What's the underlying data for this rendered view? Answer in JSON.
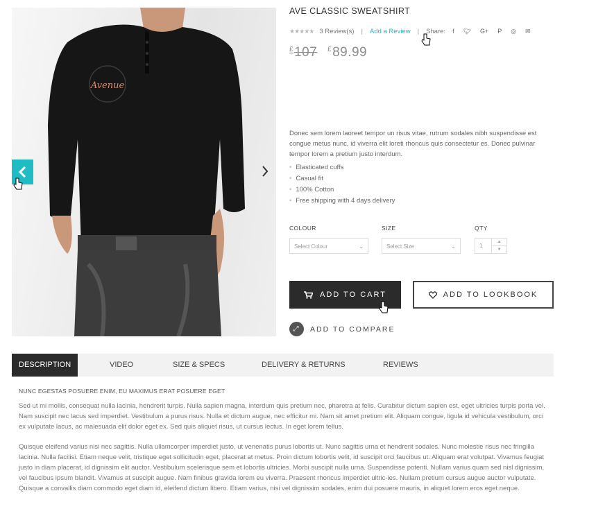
{
  "product": {
    "title": "AVE CLASSIC SWEATSHIRT",
    "logo_text": "Avenue",
    "rating_stars": 4.5,
    "reviews_label": "3 Review(s)",
    "add_review_label": "Add a Review",
    "share_label": "Share:",
    "share_icons": [
      "facebook-icon",
      "twitter-icon",
      "google-plus-icon",
      "pinterest-icon",
      "instagram-icon",
      "email-icon"
    ],
    "currency_symbol": "£",
    "old_price": "107",
    "new_price": "89.99",
    "description": "Donec sem lorem laoreet tempor un risus vitae, rutrum sodales nibh suspendisse est congue metus nunc, id viverra elit loreti rhoncus quis consectetur es. Donec pulvinar tempor lorem a pretium justo interdum.",
    "features": [
      "Elasticated cuffs",
      "Casual fit",
      "100% Cotton",
      "Free shipping with 4 days delivery"
    ]
  },
  "options": {
    "colour_label": "COLOUR",
    "colour_placeholder": "Select Colour",
    "size_label": "SIZE",
    "size_placeholder": "Select Size",
    "qty_label": "QTY",
    "qty_value": "1"
  },
  "actions": {
    "add_to_cart": "ADD TO CART",
    "add_to_lookbook": "ADD TO LOOKBOOK",
    "add_to_compare": "ADD TO COMPARE"
  },
  "tabs": [
    {
      "label": "DESCRIPTION",
      "active": true
    },
    {
      "label": "VIDEO"
    },
    {
      "label": "SIZE & SPECS"
    },
    {
      "label": "DELIVERY & RETURNS"
    },
    {
      "label": "REVIEWS"
    }
  ],
  "description_tab": {
    "heading": "NUNC EGESTAS POSUERE ENIM, EU MAXIMUS ERAT POSUERE EGET",
    "paragraphs": [
      "Sed ut mi mollis, consequat nulla lacinia, hendrerit turpis. Nulla sapien magna, interdum quis pretium nec, pharetra at felis. Curabitur dictum sapien est, eget ultricies turpis porta vel. Nam suscipit nec lacus sed imperdiet. Vestibulum a purus risus. Nulla et dictum augue, nec efficitur mi. Nam sit amet pretium elit. Aliquam congue, ligula id vehicula vestibulum, orci ex vulputate lacus, ac malesuada elit dolor eget ex. Sed quis aliquet risus, ut cursus lectus. In eget lorem tellus.",
      "Quisque eleifend varius nisi nec sagittis. Nulla ullamcorper imperdiet justo, ut venenatis purus lobortis ut. Nunc sagittis urna et hendrerit sodales. Nunc molestie risus nec fringilla lacinia. Nulla facilisi. Etiam neque velit, tristique eget sollicitudin eget, placerat at metus. Proin dictum lobortis velit, id suscipit orci faucibus ut. Aliquam erat volutpat. Vivamus feugiat justo in diam placerat, id dignissim elit auctor. Vestibulum scelerisque sem et lobortis ultricies. Morbi suscipit nulla urna. Suspendisse potenti. Nullam varius quam sed nisl dignissim, vel faucibus ipsum blandit. Vivamus at suscipit augue. Nam finibus gravida lorem eu viverra. Praesent rhoncus imperdiet ultric-ies. Nullam pretium cursus augue auctor vulputate. Quisque a convallis diam commodo eget diam id, eleifend dictum libero. Etiam varius, nisi vel dignissim sodales, enim dui posuere mauris, in aliquet lorem eros eget neque."
    ]
  },
  "colors": {
    "accent": "#1fbcc4",
    "dark": "#2b2b2b"
  }
}
